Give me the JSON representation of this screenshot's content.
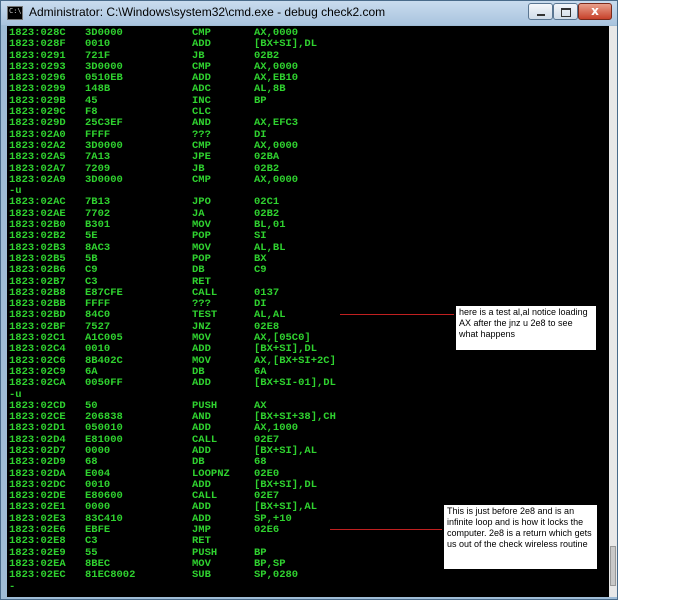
{
  "window": {
    "title": "Administrator: C:\\Windows\\system32\\cmd.exe - debug  check2.com",
    "close_label": "x"
  },
  "lines": [
    {
      "addr": "1823:028C",
      "hex": "3D0000",
      "op": "CMP",
      "args": "AX,0000"
    },
    {
      "addr": "1823:028F",
      "hex": "0010",
      "op": "ADD",
      "args": "[BX+SI],DL"
    },
    {
      "addr": "1823:0291",
      "hex": "721F",
      "op": "JB",
      "args": "02B2"
    },
    {
      "addr": "1823:0293",
      "hex": "3D0000",
      "op": "CMP",
      "args": "AX,0000"
    },
    {
      "addr": "1823:0296",
      "hex": "0510EB",
      "op": "ADD",
      "args": "AX,EB10"
    },
    {
      "addr": "1823:0299",
      "hex": "148B",
      "op": "ADC",
      "args": "AL,8B"
    },
    {
      "addr": "1823:029B",
      "hex": "45",
      "op": "INC",
      "args": "BP"
    },
    {
      "addr": "1823:029C",
      "hex": "F8",
      "op": "CLC",
      "args": ""
    },
    {
      "addr": "1823:029D",
      "hex": "25C3EF",
      "op": "AND",
      "args": "AX,EFC3"
    },
    {
      "addr": "1823:02A0",
      "hex": "FFFF",
      "op": "???",
      "args": "DI"
    },
    {
      "addr": "1823:02A2",
      "hex": "3D0000",
      "op": "CMP",
      "args": "AX,0000"
    },
    {
      "addr": "1823:02A5",
      "hex": "7A13",
      "op": "JPE",
      "args": "02BA"
    },
    {
      "addr": "1823:02A7",
      "hex": "7209",
      "op": "JB",
      "args": "02B2"
    },
    {
      "addr": "1823:02A9",
      "hex": "3D0000",
      "op": "CMP",
      "args": "AX,0000"
    },
    {
      "addr": "-u",
      "hex": "",
      "op": "",
      "args": ""
    },
    {
      "addr": "1823:02AC",
      "hex": "7B13",
      "op": "JPO",
      "args": "02C1"
    },
    {
      "addr": "1823:02AE",
      "hex": "7702",
      "op": "JA",
      "args": "02B2"
    },
    {
      "addr": "1823:02B0",
      "hex": "B301",
      "op": "MOV",
      "args": "BL,01"
    },
    {
      "addr": "1823:02B2",
      "hex": "5E",
      "op": "POP",
      "args": "SI"
    },
    {
      "addr": "1823:02B3",
      "hex": "8AC3",
      "op": "MOV",
      "args": "AL,BL"
    },
    {
      "addr": "1823:02B5",
      "hex": "5B",
      "op": "POP",
      "args": "BX"
    },
    {
      "addr": "1823:02B6",
      "hex": "C9",
      "op": "DB",
      "args": "C9"
    },
    {
      "addr": "1823:02B7",
      "hex": "C3",
      "op": "RET",
      "args": ""
    },
    {
      "addr": "1823:02B8",
      "hex": "E87CFE",
      "op": "CALL",
      "args": "0137"
    },
    {
      "addr": "1823:02BB",
      "hex": "FFFF",
      "op": "???",
      "args": "DI"
    },
    {
      "addr": "1823:02BD",
      "hex": "84C0",
      "op": "TEST",
      "args": "AL,AL"
    },
    {
      "addr": "1823:02BF",
      "hex": "7527",
      "op": "JNZ",
      "args": "02E8"
    },
    {
      "addr": "1823:02C1",
      "hex": "A1C005",
      "op": "MOV",
      "args": "AX,[05C0]"
    },
    {
      "addr": "1823:02C4",
      "hex": "0010",
      "op": "ADD",
      "args": "[BX+SI],DL"
    },
    {
      "addr": "1823:02C6",
      "hex": "8B402C",
      "op": "MOV",
      "args": "AX,[BX+SI+2C]"
    },
    {
      "addr": "1823:02C9",
      "hex": "6A",
      "op": "DB",
      "args": "6A"
    },
    {
      "addr": "1823:02CA",
      "hex": "0050FF",
      "op": "ADD",
      "args": "[BX+SI-01],DL"
    },
    {
      "addr": "-u",
      "hex": "",
      "op": "",
      "args": ""
    },
    {
      "addr": "1823:02CD",
      "hex": "50",
      "op": "PUSH",
      "args": "AX"
    },
    {
      "addr": "1823:02CE",
      "hex": "206838",
      "op": "AND",
      "args": "[BX+SI+38],CH"
    },
    {
      "addr": "1823:02D1",
      "hex": "050010",
      "op": "ADD",
      "args": "AX,1000"
    },
    {
      "addr": "1823:02D4",
      "hex": "E81000",
      "op": "CALL",
      "args": "02E7"
    },
    {
      "addr": "1823:02D7",
      "hex": "0000",
      "op": "ADD",
      "args": "[BX+SI],AL"
    },
    {
      "addr": "1823:02D9",
      "hex": "68",
      "op": "DB",
      "args": "68"
    },
    {
      "addr": "1823:02DA",
      "hex": "E004",
      "op": "LOOPNZ",
      "args": "02E0"
    },
    {
      "addr": "1823:02DC",
      "hex": "0010",
      "op": "ADD",
      "args": "[BX+SI],DL"
    },
    {
      "addr": "1823:02DE",
      "hex": "E80600",
      "op": "CALL",
      "args": "02E7"
    },
    {
      "addr": "1823:02E1",
      "hex": "0000",
      "op": "ADD",
      "args": "[BX+SI],AL"
    },
    {
      "addr": "1823:02E3",
      "hex": "83C410",
      "op": "ADD",
      "args": "SP,+10"
    },
    {
      "addr": "1823:02E6",
      "hex": "EBFE",
      "op": "JMP",
      "args": "02E6"
    },
    {
      "addr": "1823:02E8",
      "hex": "C3",
      "op": "RET",
      "args": ""
    },
    {
      "addr": "1823:02E9",
      "hex": "55",
      "op": "PUSH",
      "args": "BP"
    },
    {
      "addr": "1823:02EA",
      "hex": "8BEC",
      "op": "MOV",
      "args": "BP,SP"
    },
    {
      "addr": "1823:02EC",
      "hex": "81EC8002",
      "op": "SUB",
      "args": "SP,0280"
    },
    {
      "addr": "-",
      "hex": "",
      "op": "",
      "args": ""
    }
  ],
  "annotations": {
    "note1": "here is a test al,al notice loading AX after the jnz u 2e8 to see what happens",
    "note2": "This is just before 2e8 and is an infinite loop and is how it locks the computer.  2e8 is a return which gets us out of the check wireless routine"
  },
  "colors": {
    "console_bg": "#000000",
    "console_text": "#2fd22f",
    "annotation_line": "#c02020"
  }
}
